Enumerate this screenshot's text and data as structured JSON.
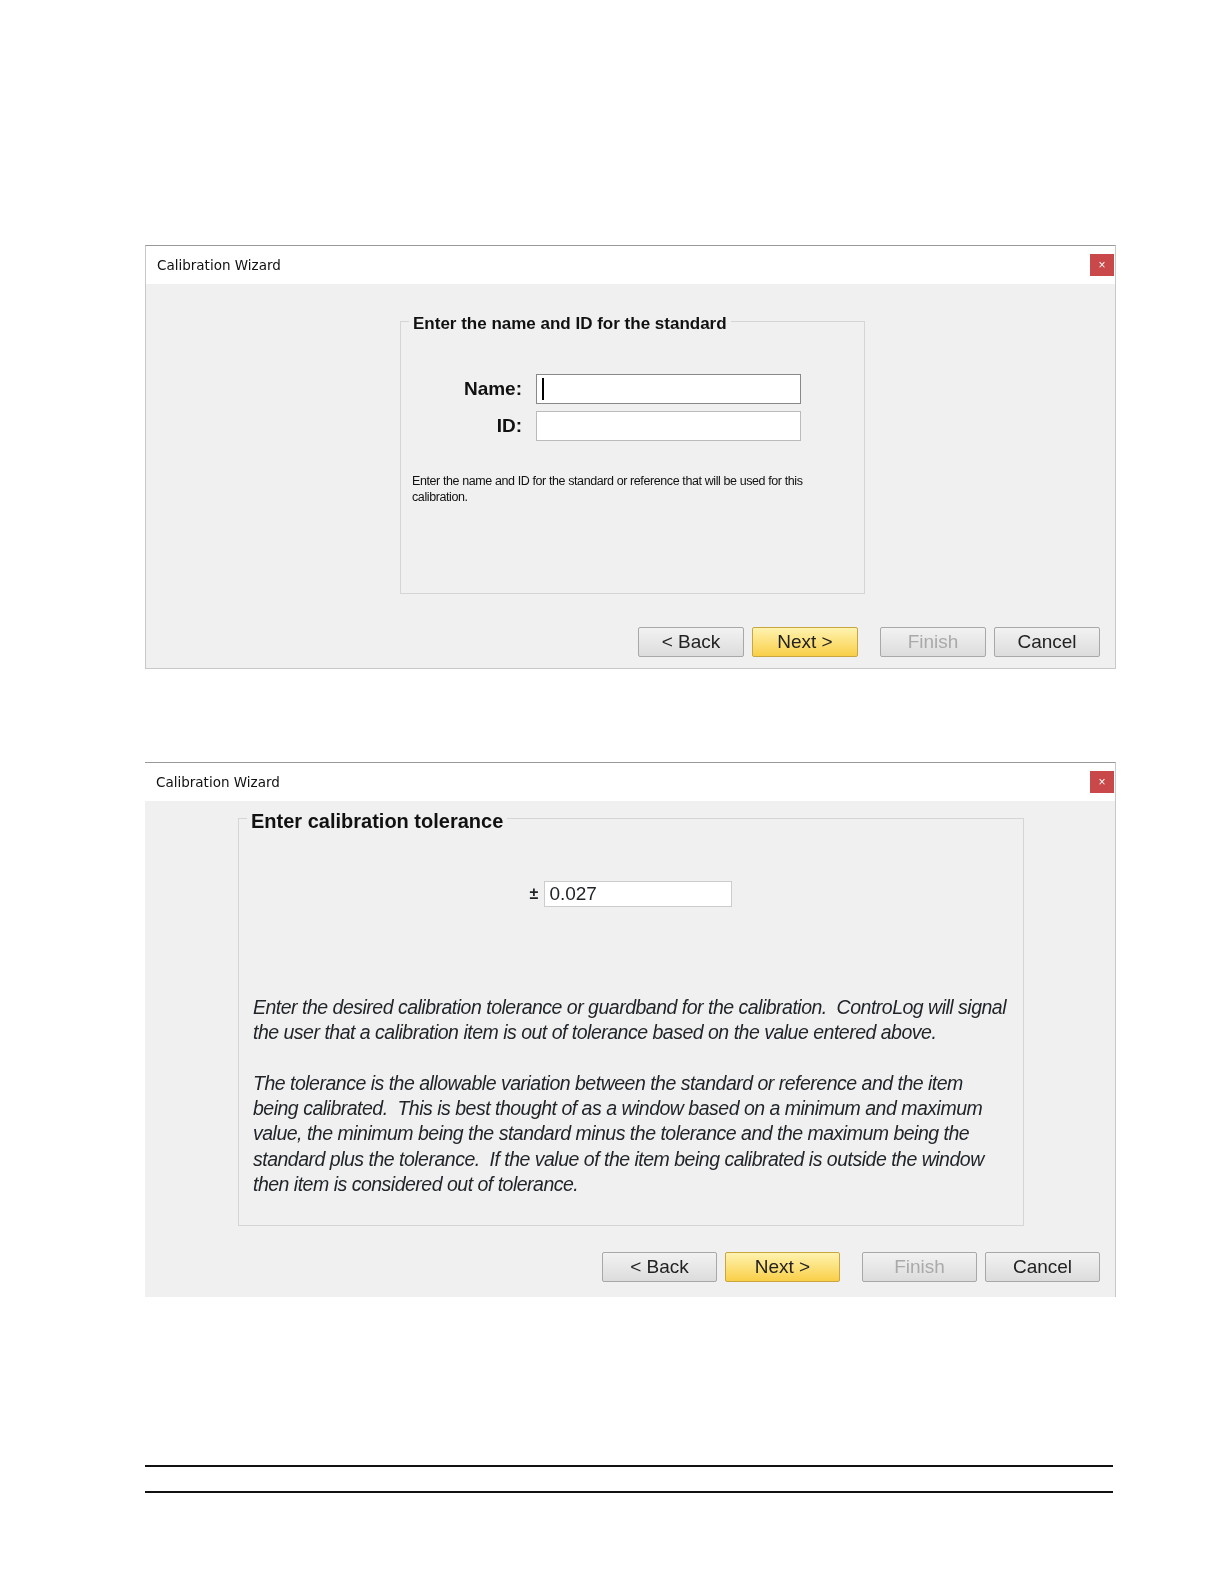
{
  "dialogs": [
    {
      "title": "Calibration Wizard",
      "close": "×",
      "kind": "labeled",
      "group_title": "Enter the name and ID for the standard",
      "fields": [
        {
          "label": "Name:",
          "focused": true
        },
        {
          "label": "ID:",
          "focused": false
        }
      ],
      "help": [
        "Enter the name and ID for the standard or reference that will be used for this calibration."
      ],
      "buttons": [
        {
          "label": "< Back",
          "kind": "normal",
          "disabled": false
        },
        {
          "label": "Next >",
          "kind": "default",
          "disabled": false
        },
        {
          "label": "Finish",
          "kind": "normal",
          "disabled": true
        },
        {
          "label": "Cancel",
          "kind": "normal",
          "disabled": false
        }
      ]
    },
    {
      "title": "Calibration Wizard",
      "close": "×",
      "kind": "prefixed",
      "group_title": "Enter calibration tolerance",
      "fields": [
        {
          "label": "±",
          "value": "0.027",
          "focused": false
        }
      ],
      "help": [
        "Enter the desired calibration tolerance or guardband for the calibration.  ControLog will signal the user that a calibration item is out of tolerance based on the value entered above.",
        "The tolerance is the allowable variation between the standard or reference and the item being calibrated.  This is best thought of as a window based on a minimum and maximum value, the minimum being the standard minus the tolerance and the maximum being the standard plus the tolerance.  If the value of the item being calibrated is outside the window then item is considered out of tolerance."
      ],
      "buttons": [
        {
          "label": "< Back",
          "kind": "normal",
          "disabled": false
        },
        {
          "label": "Next >",
          "kind": "default",
          "disabled": false
        },
        {
          "label": "Finish",
          "kind": "normal",
          "disabled": true
        },
        {
          "label": "Cancel",
          "kind": "normal",
          "disabled": false
        }
      ]
    }
  ]
}
